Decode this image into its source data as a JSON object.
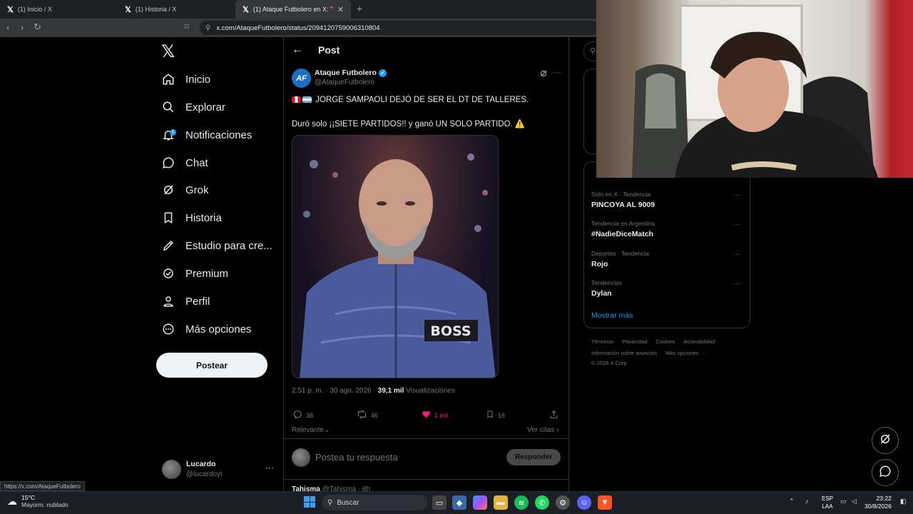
{
  "browser": {
    "tabs": [
      {
        "label": "(1) Inicio / X"
      },
      {
        "label": "(1) Historia / X"
      },
      {
        "label": "(1) Ataque Futbolero en X: \"🇵🇪🇦"
      }
    ],
    "new_tab_icon": "+",
    "url": "x.com/AtaqueFutbolero/status/2094120759006310804",
    "status_url": "https://x.com/AtaqueFutbolero"
  },
  "nav": {
    "items": [
      {
        "label": "Inicio",
        "icon": "home-icon"
      },
      {
        "label": "Explorar",
        "icon": "search-icon"
      },
      {
        "label": "Notificaciones",
        "icon": "bell-icon",
        "badge": "1"
      },
      {
        "label": "Chat",
        "icon": "chat-icon"
      },
      {
        "label": "Grok",
        "icon": "grok-icon"
      },
      {
        "label": "Historia",
        "icon": "bookmark-icon"
      },
      {
        "label": "Estudio para cre...",
        "icon": "rocket-icon"
      },
      {
        "label": "Premium",
        "icon": "premium-icon"
      },
      {
        "label": "Perfil",
        "icon": "person-icon"
      },
      {
        "label": "Más opciones",
        "icon": "more-circle-icon"
      }
    ],
    "post_button": "Postear",
    "account": {
      "name": "Lucardo",
      "handle": "@lucardoyt"
    }
  },
  "post": {
    "header_title": "Post",
    "author": {
      "name": "Ataque Futbolero",
      "handle": "@AtaqueFutbolero"
    },
    "text_line1": "JORGE SAMPAOLI DEJÓ DE SER EL DT DE TALLERES.",
    "text_line2": "Duró solo ¡¡SIETE PARTIDOS!! y ganó UN SOLO PARTIDO. ⚠️",
    "timestamp": "2:51 p. m. · 30 ago. 2026 · ",
    "views": "39,1 mil",
    "views_label": " Visualizaciones",
    "actions": {
      "replies": "38",
      "reposts": "46",
      "likes": "1 mil",
      "bookmarks": "16"
    },
    "photo_jacket_text": "BOSS",
    "sort_label": "Relevante",
    "quotes_label": "Ver citas",
    "reply_placeholder": "Postea tu respuesta",
    "reply_button": "Responder",
    "next_reply_name": "Tahisma",
    "next_reply_handle": "@Tahisma · 8h"
  },
  "trends": [
    {
      "context": "Solo en X · Tendencia",
      "name": "PINCOYA AL 9009"
    },
    {
      "context": "Tendencia en Argentina",
      "name": "#NadieDiceMatch"
    },
    {
      "context": "Deportes · Tendencia",
      "name": "Rojo"
    },
    {
      "context": "Tendencias",
      "name": "Dylan"
    }
  ],
  "trends_more": "Mostrar más",
  "footer": {
    "line1": [
      "Términos",
      "Privacidad",
      "Cookies",
      "Accesibilidad"
    ],
    "line2": [
      "Información sobre anuncios",
      "Más opciones ···"
    ],
    "copyright": "© 2026 X Corp."
  },
  "taskbar": {
    "weather_temp": "15°C",
    "weather_cond": "Mayorm. nublado",
    "search_label": "Buscar",
    "lang_line1": "ESP",
    "lang_line2": "LAA",
    "time": "23:22",
    "date": "30/8/2026"
  },
  "colors": {
    "accent": "#1d9bf0",
    "like": "#f91880",
    "background": "#000000"
  }
}
